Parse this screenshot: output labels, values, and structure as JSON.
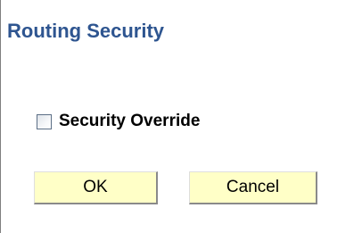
{
  "dialog": {
    "title": "Routing Security"
  },
  "security_override": {
    "label": "Security Override",
    "checked": false
  },
  "buttons": {
    "ok_label": "OK",
    "cancel_label": "Cancel",
    "color": "#ffffc7"
  },
  "colors": {
    "title": "#2e5590"
  }
}
